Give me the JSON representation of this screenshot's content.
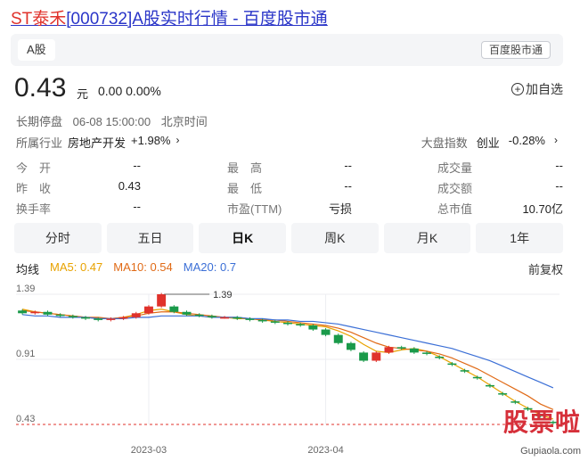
{
  "page": {
    "title_prefix": "ST泰禾",
    "title_rest": "[000732]A股实时行情 - 百度股市通"
  },
  "market": {
    "tab": "A股",
    "brand": "百度股市通"
  },
  "quote": {
    "price": "0.43",
    "unit": "元",
    "change": "0.00 0.00%",
    "watch_label": "加自选",
    "status": "长期停盘",
    "time": "06-08 15:00:00",
    "timezone": "北京时间"
  },
  "industry": {
    "label": "所属行业",
    "name": "房地产开发",
    "change": "+1.98%",
    "index_label": "大盘指数",
    "index_name": "创业",
    "index_change": "-0.28%"
  },
  "stats": [
    [
      {
        "label": "今　开",
        "value": "--"
      },
      {
        "label": "最　高",
        "value": "--"
      },
      {
        "label": "成交量",
        "value": "--"
      }
    ],
    [
      {
        "label": "昨　收",
        "value": "0.43"
      },
      {
        "label": "最　低",
        "value": "--"
      },
      {
        "label": "成交额",
        "value": "--"
      }
    ],
    [
      {
        "label": "换手率",
        "value": "--"
      },
      {
        "label": "市盈(TTM)",
        "value": "亏损"
      },
      {
        "label": "总市值",
        "value": "10.70亿"
      }
    ]
  ],
  "periods": [
    "分时",
    "五日",
    "日K",
    "周K",
    "月K",
    "1年"
  ],
  "active_period": "日K",
  "ma": {
    "label": "均线",
    "ma5": "MA5: 0.47",
    "ma10": "MA10: 0.54",
    "ma20": "MA20: 0.7",
    "adjust": "前复权"
  },
  "chart_data": {
    "type": "candlestick",
    "y_ticks": [
      "1.39",
      "0.91",
      "0.43"
    ],
    "x_ticks": [
      "2023-03",
      "2023-04"
    ],
    "max_annotation": "1.39",
    "ylim": [
      0.43,
      1.39
    ],
    "colors": {
      "up": "#e0322b",
      "down": "#1a9a4a",
      "ma5": "#e8a200",
      "ma10": "#e06a16",
      "ma20": "#3b6fd6"
    },
    "series": [
      {
        "name": "MA5",
        "values": [
          1.28,
          1.26,
          1.25,
          1.24,
          1.23,
          1.22,
          1.21,
          1.21,
          1.22,
          1.24,
          1.27,
          1.28,
          1.26,
          1.24,
          1.23,
          1.22,
          1.22,
          1.21,
          1.21,
          1.2,
          1.19,
          1.18,
          1.17,
          1.16,
          1.15,
          1.12,
          1.08,
          1.02,
          0.97,
          0.96,
          0.98,
          0.99,
          0.97,
          0.93,
          0.88,
          0.83,
          0.78,
          0.72,
          0.66,
          0.6,
          0.55,
          0.5,
          0.47
        ]
      },
      {
        "name": "MA10",
        "values": [
          1.27,
          1.26,
          1.25,
          1.24,
          1.23,
          1.22,
          1.22,
          1.21,
          1.22,
          1.23,
          1.25,
          1.26,
          1.26,
          1.25,
          1.24,
          1.23,
          1.22,
          1.22,
          1.21,
          1.2,
          1.2,
          1.19,
          1.18,
          1.17,
          1.16,
          1.14,
          1.11,
          1.07,
          1.03,
          1.0,
          0.99,
          0.98,
          0.97,
          0.95,
          0.92,
          0.88,
          0.84,
          0.79,
          0.74,
          0.69,
          0.64,
          0.58,
          0.54
        ]
      },
      {
        "name": "MA20",
        "values": [
          1.24,
          1.23,
          1.23,
          1.22,
          1.22,
          1.22,
          1.21,
          1.21,
          1.21,
          1.22,
          1.22,
          1.23,
          1.23,
          1.23,
          1.23,
          1.22,
          1.22,
          1.22,
          1.21,
          1.21,
          1.2,
          1.2,
          1.19,
          1.19,
          1.18,
          1.17,
          1.15,
          1.13,
          1.11,
          1.09,
          1.07,
          1.05,
          1.03,
          1.01,
          0.99,
          0.96,
          0.93,
          0.9,
          0.86,
          0.82,
          0.78,
          0.74,
          0.7
        ]
      }
    ],
    "candles": [
      {
        "o": 1.27,
        "c": 1.25
      },
      {
        "o": 1.25,
        "c": 1.26
      },
      {
        "o": 1.26,
        "c": 1.24
      },
      {
        "o": 1.24,
        "c": 1.23
      },
      {
        "o": 1.23,
        "c": 1.22
      },
      {
        "o": 1.22,
        "c": 1.21
      },
      {
        "o": 1.21,
        "c": 1.2
      },
      {
        "o": 1.2,
        "c": 1.21
      },
      {
        "o": 1.21,
        "c": 1.22
      },
      {
        "o": 1.22,
        "c": 1.25
      },
      {
        "o": 1.25,
        "c": 1.3
      },
      {
        "o": 1.3,
        "c": 1.39
      },
      {
        "o": 1.3,
        "c": 1.26
      },
      {
        "o": 1.26,
        "c": 1.24
      },
      {
        "o": 1.24,
        "c": 1.23
      },
      {
        "o": 1.23,
        "c": 1.22
      },
      {
        "o": 1.22,
        "c": 1.22
      },
      {
        "o": 1.22,
        "c": 1.21
      },
      {
        "o": 1.21,
        "c": 1.2
      },
      {
        "o": 1.2,
        "c": 1.19
      },
      {
        "o": 1.19,
        "c": 1.18
      },
      {
        "o": 1.18,
        "c": 1.17
      },
      {
        "o": 1.17,
        "c": 1.16
      },
      {
        "o": 1.16,
        "c": 1.13
      },
      {
        "o": 1.13,
        "c": 1.09
      },
      {
        "o": 1.09,
        "c": 1.03
      },
      {
        "o": 1.03,
        "c": 0.98
      },
      {
        "o": 0.96,
        "c": 0.9
      },
      {
        "o": 0.9,
        "c": 0.96
      },
      {
        "o": 0.96,
        "c": 1.0
      },
      {
        "o": 1.0,
        "c": 0.99
      },
      {
        "o": 0.99,
        "c": 0.96
      },
      {
        "o": 0.96,
        "c": 0.95
      },
      {
        "o": 0.93,
        "c": 0.92
      },
      {
        "o": 0.88,
        "c": 0.87
      },
      {
        "o": 0.83,
        "c": 0.82
      },
      {
        "o": 0.78,
        "c": 0.77
      },
      {
        "o": 0.72,
        "c": 0.71
      },
      {
        "o": 0.66,
        "c": 0.65
      },
      {
        "o": 0.6,
        "c": 0.59
      },
      {
        "o": 0.55,
        "c": 0.54
      },
      {
        "o": 0.5,
        "c": 0.49
      },
      {
        "o": 0.45,
        "c": 0.44
      }
    ]
  },
  "watermark": {
    "brand": "股票啦",
    "site": "Gupiaola.com"
  }
}
